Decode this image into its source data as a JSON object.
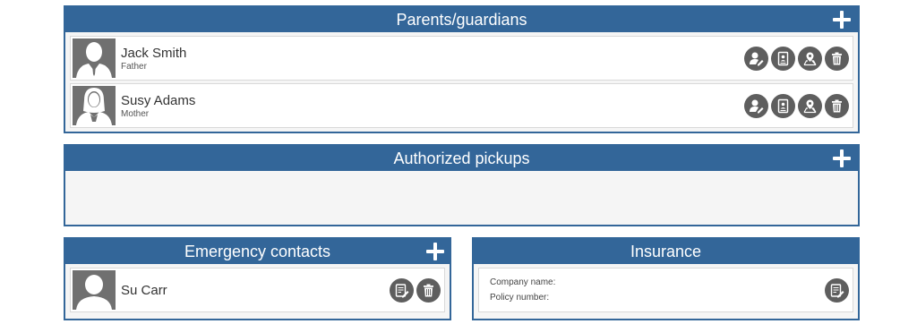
{
  "parents": {
    "title": "Parents/guardians",
    "people": [
      {
        "name": "Jack Smith",
        "relation": "Father"
      },
      {
        "name": "Susy Adams",
        "relation": "Mother"
      }
    ]
  },
  "pickups": {
    "title": "Authorized pickups"
  },
  "emergency": {
    "title": "Emergency contacts",
    "people": [
      {
        "name": "Su Carr"
      }
    ]
  },
  "insurance": {
    "title": "Insurance",
    "company_label": "Company name:",
    "policy_label": "Policy number:"
  },
  "icons": {
    "add": "plus-icon",
    "edit_user": "user-edit-icon",
    "contact_card": "contact-card-icon",
    "location": "location-icon",
    "delete": "trash-icon",
    "edit": "edit-note-icon"
  },
  "colors": {
    "header": "#336699",
    "icon_button": "#5e5e5e",
    "avatar": "#707070"
  }
}
